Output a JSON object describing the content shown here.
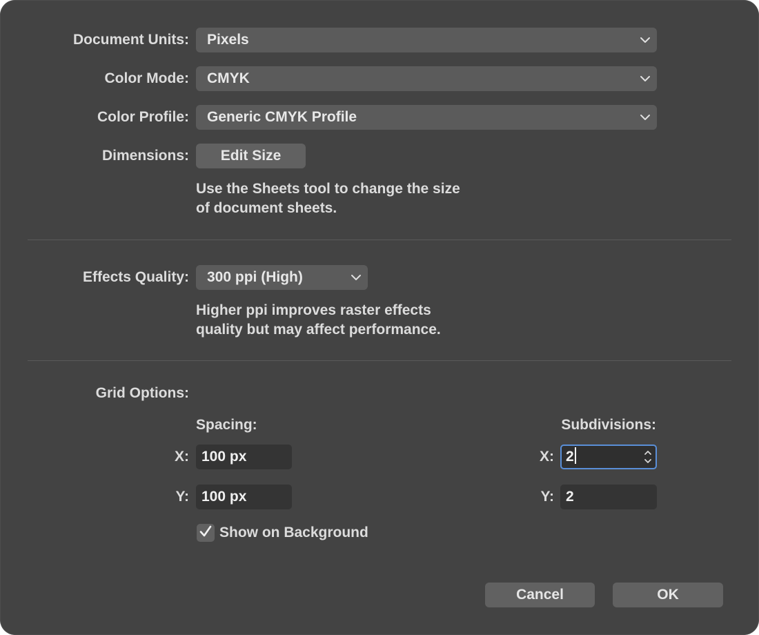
{
  "document_units": {
    "label": "Document Units:",
    "value": "Pixels"
  },
  "color_mode": {
    "label": "Color Mode:",
    "value": "CMYK"
  },
  "color_profile": {
    "label": "Color Profile:",
    "value": "Generic CMYK Profile"
  },
  "dimensions": {
    "label": "Dimensions:",
    "button": "Edit Size",
    "help_line1": "Use the Sheets tool to change the size",
    "help_line2": "of document sheets."
  },
  "effects_quality": {
    "label": "Effects Quality:",
    "value": "300 ppi (High)",
    "help_line1": "Higher ppi improves raster effects",
    "help_line2": "quality but may affect performance."
  },
  "grid": {
    "label": "Grid Options:",
    "spacing_label": "Spacing:",
    "subdivisions_label": "Subdivisions:",
    "x_label": "X:",
    "y_label": "Y:",
    "spacing_x": "100 px",
    "spacing_y": "100 px",
    "subdiv_x": "2",
    "subdiv_y": "2",
    "show_on_background": {
      "label": "Show on Background",
      "checked": true
    }
  },
  "buttons": {
    "cancel": "Cancel",
    "ok": "OK"
  },
  "icons": {
    "dropdown": "chevron-down-icon",
    "stepper": "stepper-icon",
    "checkmark": "checkmark-icon"
  },
  "colors": {
    "focus_ring": "#5a8fd8",
    "dialog_bg": "#434343"
  }
}
